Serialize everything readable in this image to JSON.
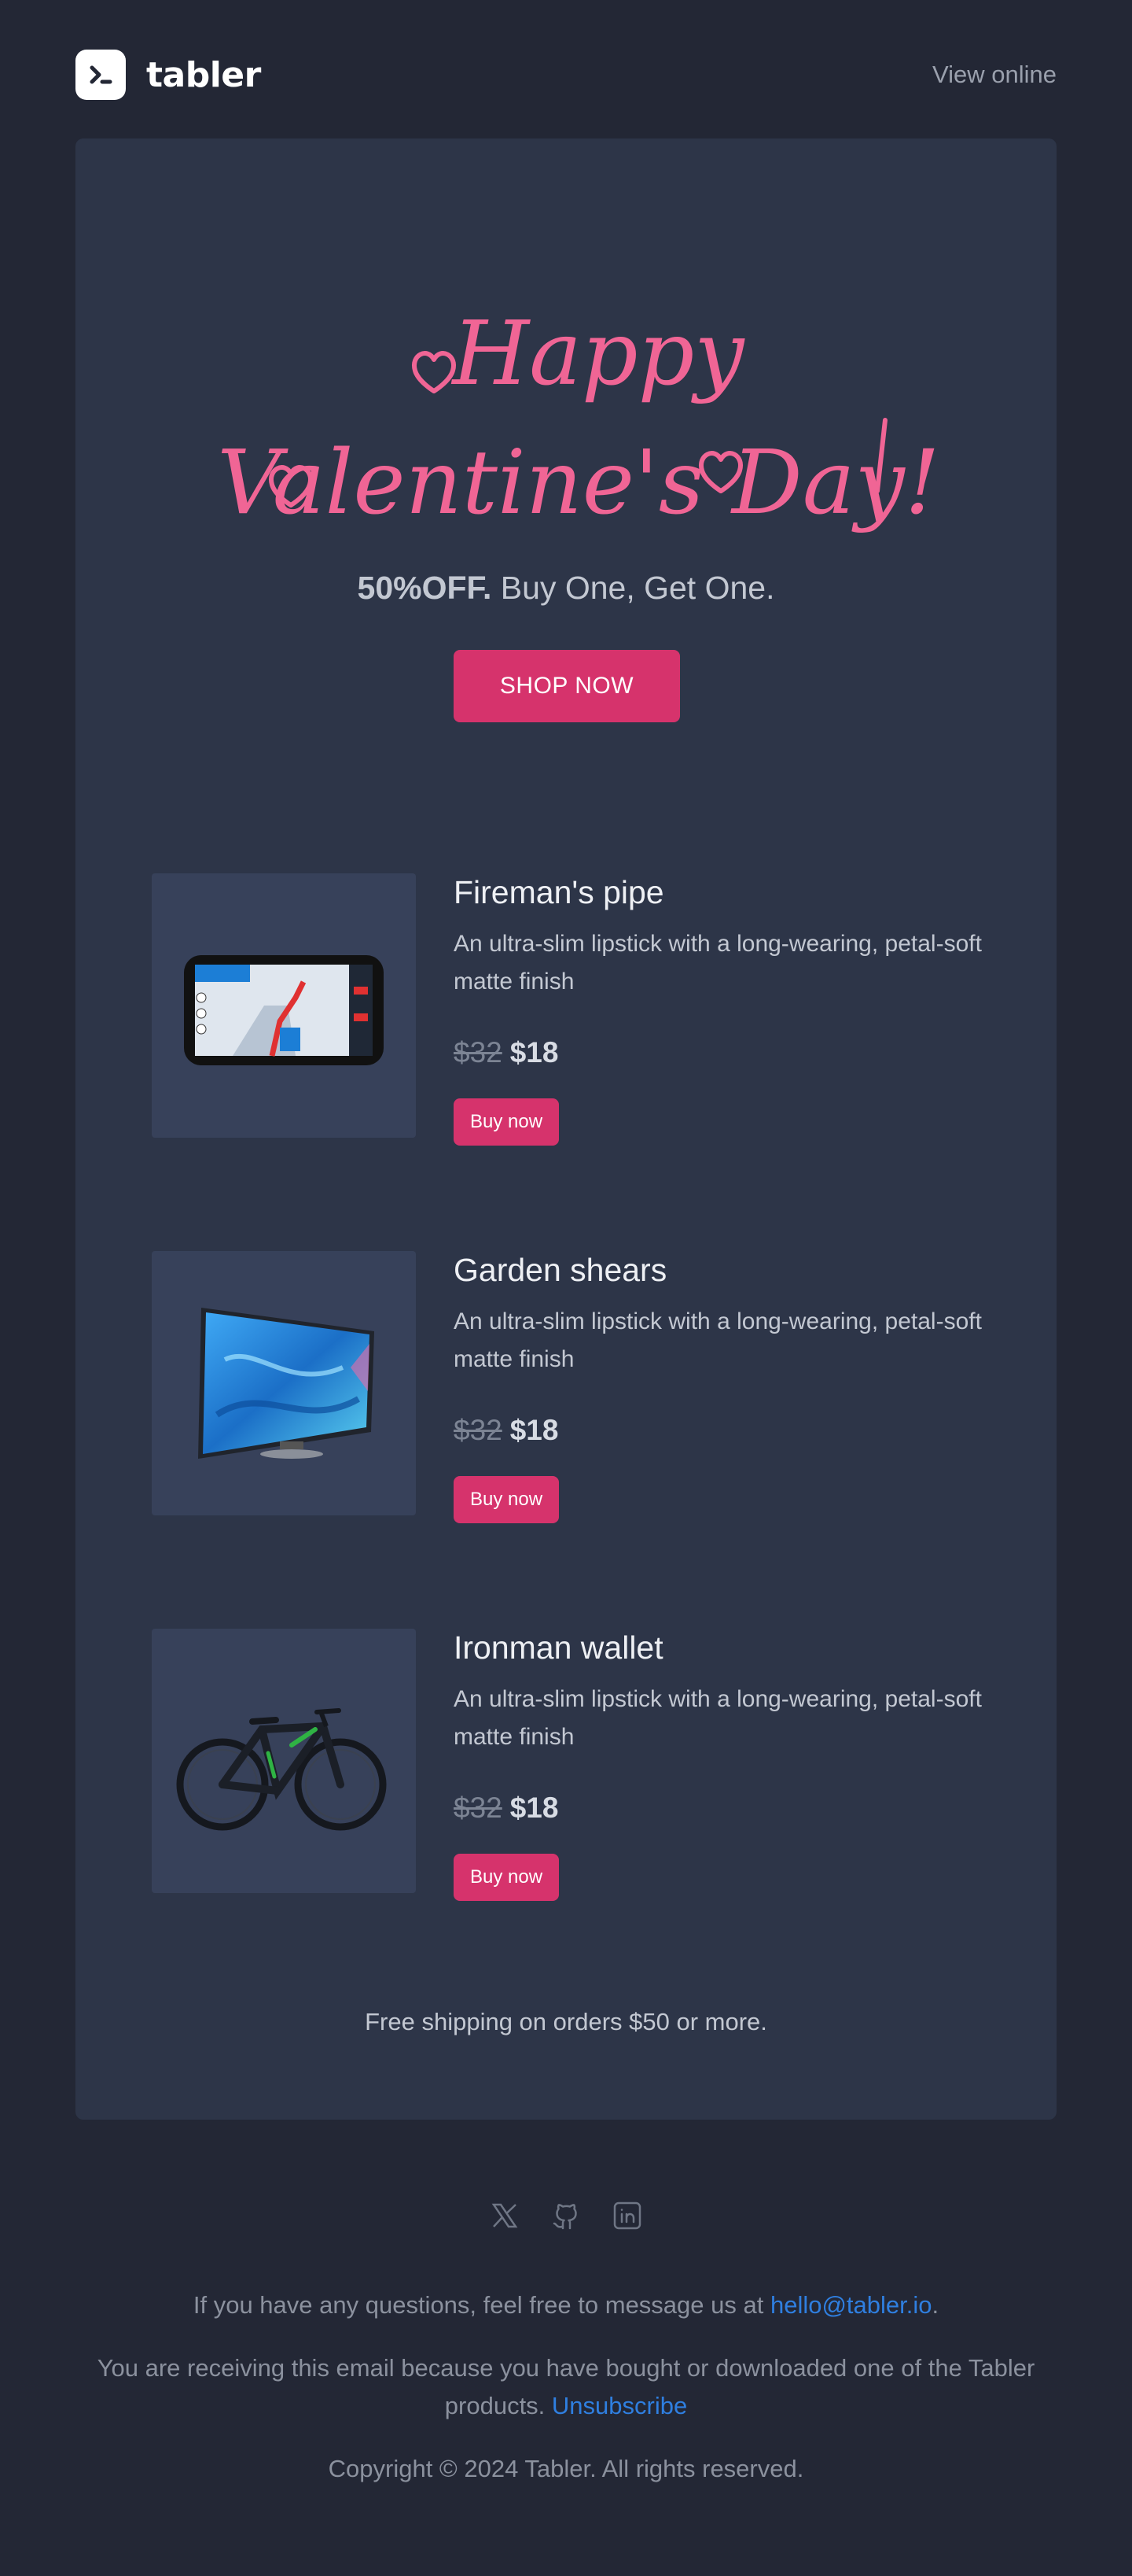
{
  "header": {
    "brand_name": "tabler",
    "view_online_label": "View online"
  },
  "hero": {
    "headline_line1": "Happy",
    "headline_line2": "Valentine's Day!",
    "promo_bold": "50%OFF.",
    "promo_rest": " Buy One, Get One.",
    "cta_label": "SHOP NOW"
  },
  "products": [
    {
      "title": "Fireman's pipe",
      "description": "An ultra-slim lipstick with a long-wearing, petal-soft matte finish",
      "old_price": "$32",
      "new_price": "$18",
      "buy_label": "Buy now",
      "image_icon": "gps-navigator-image"
    },
    {
      "title": "Garden shears",
      "description": "An ultra-slim lipstick with a long-wearing, petal-soft matte finish",
      "old_price": "$32",
      "new_price": "$18",
      "buy_label": "Buy now",
      "image_icon": "television-image"
    },
    {
      "title": "Ironman wallet",
      "description": "An ultra-slim lipstick with a long-wearing, petal-soft matte finish",
      "old_price": "$32",
      "new_price": "$18",
      "buy_label": "Buy now",
      "image_icon": "bicycle-image"
    }
  ],
  "shipping_note": "Free shipping on orders $50 or more.",
  "footer": {
    "social_icons": [
      "x-icon",
      "github-icon",
      "linkedin-icon"
    ],
    "question_text": "If you have any questions, feel free to message us at ",
    "email": "hello@tabler.io",
    "question_end": ".",
    "receiving_text": "You are receiving this email because you have bought or downloaded one of the Tabler products. ",
    "unsubscribe_label": "Unsubscribe",
    "copyright": "Copyright © 2024 Tabler. All rights reserved."
  },
  "colors": {
    "background": "#232735",
    "card": "#2d3548",
    "accent_pink": "#d6336c",
    "script_pink": "#f06595",
    "link_blue": "#2f7fe0"
  }
}
